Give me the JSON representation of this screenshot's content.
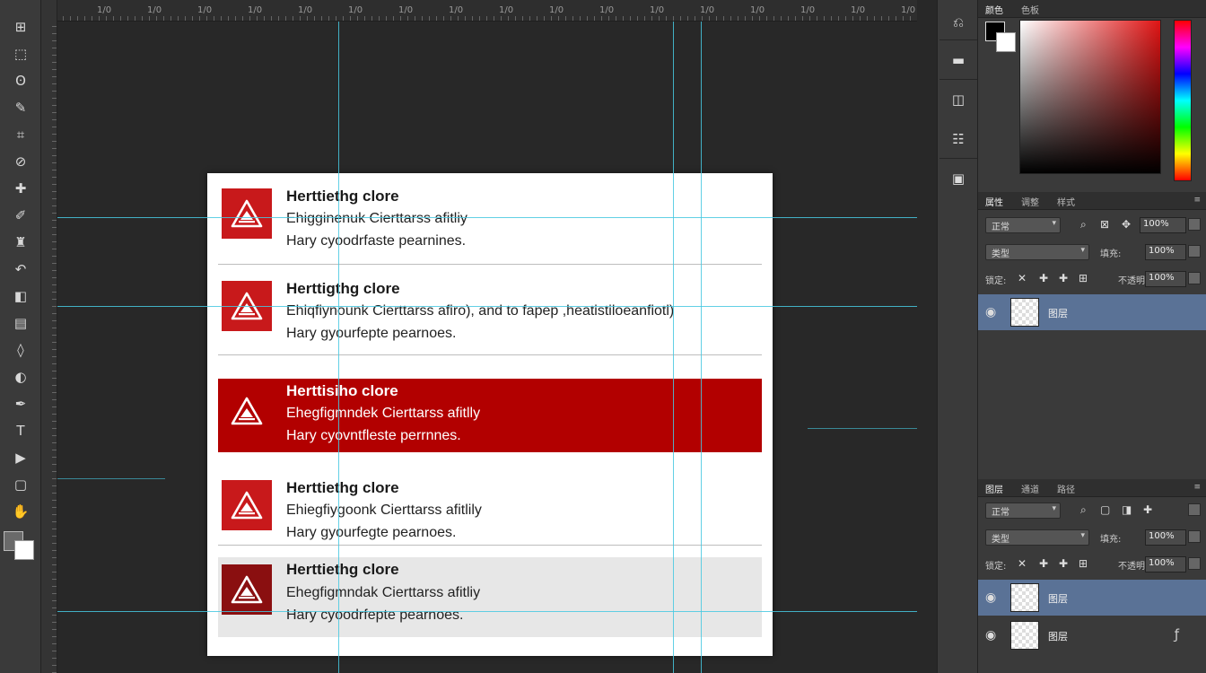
{
  "toolbar": {
    "tools": [
      {
        "name": "move-tool",
        "glyph": "⊞"
      },
      {
        "name": "marquee-tool",
        "glyph": "⬚"
      },
      {
        "name": "lasso-tool",
        "glyph": "ʘ"
      },
      {
        "name": "quick-select-tool",
        "glyph": "✎"
      },
      {
        "name": "crop-tool",
        "glyph": "⌗"
      },
      {
        "name": "eyedropper-tool",
        "glyph": "⊘"
      },
      {
        "name": "healing-tool",
        "glyph": "✚"
      },
      {
        "name": "brush-tool",
        "glyph": "✐"
      },
      {
        "name": "stamp-tool",
        "glyph": "♜"
      },
      {
        "name": "history-brush-tool",
        "glyph": "↶"
      },
      {
        "name": "eraser-tool",
        "glyph": "◧"
      },
      {
        "name": "gradient-tool",
        "glyph": "▤"
      },
      {
        "name": "blur-tool",
        "glyph": "◊"
      },
      {
        "name": "dodge-tool",
        "glyph": "◐"
      },
      {
        "name": "pen-tool",
        "glyph": "✒"
      },
      {
        "name": "type-tool",
        "glyph": "T"
      },
      {
        "name": "path-select-tool",
        "glyph": "▶"
      },
      {
        "name": "shape-tool",
        "glyph": "▢"
      },
      {
        "name": "hand-tool",
        "glyph": "✋"
      },
      {
        "name": "zoom-tool",
        "glyph": "⌕"
      }
    ]
  },
  "document": {
    "alerts": [
      {
        "title": "Herttiethg clore",
        "line1": "Ehigginenuk Cierttarss afitliy",
        "line2": "Hary cyoodrfaste pearnines."
      },
      {
        "title": "Herttigthg clore",
        "line1": "Ehiqfiynounk Cierttarss afiro), and to fapep ,heatistiloeanfiotl)",
        "line2": "Hary gyourfepte pearnoes."
      },
      {
        "title": "Herttisiho clore",
        "line1": "Ehegfigmndek Cierttarss afitlly",
        "line2": "Hary cyovntfleste perrnnes."
      },
      {
        "title": "Herttiethg clore",
        "line1": "Ehiegfiygoonk Cierttarss afitlily",
        "line2": "Hary gyourfegte pearnoes."
      },
      {
        "title": "Herttiethg clore",
        "line1": "Ehegfigmndak Cierttarss afitliy",
        "line2": "Hary cyoodrfepte pearnoes."
      }
    ]
  },
  "rulers": {
    "top_labels": [
      "1/0",
      "1/0",
      "1/0",
      "1/0",
      "1/0",
      "1/0",
      "1/0",
      "1/0",
      "1/0",
      "1/0",
      "1/0",
      "1/0",
      "1/0",
      "1/0",
      "1/0",
      "1/0",
      "1/0"
    ]
  },
  "panels": {
    "color_tabs": [
      "颜色",
      "色板"
    ],
    "adjust_tabs": [
      "属性",
      "调整",
      "样式"
    ],
    "layers_tabs": [
      "图层",
      "通道",
      "路径"
    ],
    "upper": {
      "blend_mode": "正常",
      "opacity_label": "不透明度:",
      "opacity_value": "100%",
      "kind": "类型",
      "fill_label": "填充:",
      "fill_value": "100%",
      "lock_label": "锁定:",
      "lock_value": "100%"
    },
    "lower": {
      "blend_mode": "正常",
      "opacity_label": "不透明度:",
      "opacity_value": "100%",
      "kind": "类型",
      "fill_label": "填充:",
      "fill_value": "100%",
      "lock_label": "锁定:",
      "lock_value": "100%"
    },
    "upper_layers": [
      {
        "name": "图层"
      }
    ],
    "lower_layers": [
      {
        "name": "图层"
      },
      {
        "name": "图层"
      }
    ],
    "color_label": "颜色"
  },
  "colors": {
    "accent_red": "#c8191b",
    "active_row": "#b20000",
    "guide": "#46c8e0",
    "selection": "#5a7296"
  }
}
